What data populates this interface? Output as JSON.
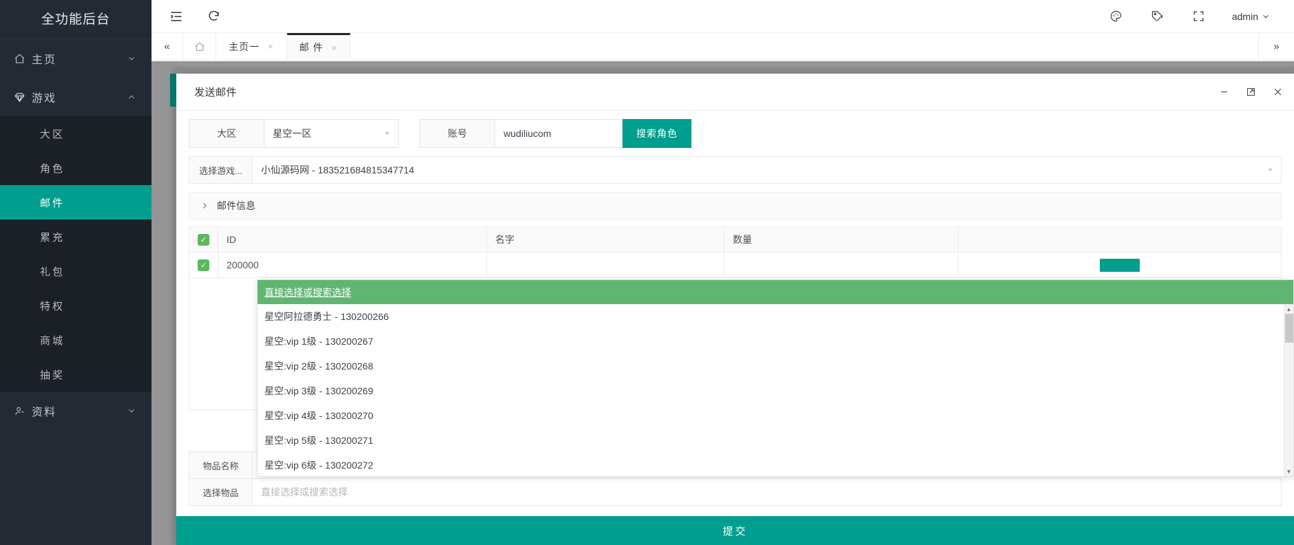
{
  "sidebar": {
    "brand": "全功能后台",
    "groups": [
      {
        "label": "主页",
        "icon": "home-icon",
        "expanded": false,
        "items": []
      },
      {
        "label": "游戏",
        "icon": "diamond-icon",
        "expanded": true,
        "items": [
          {
            "label": "大区",
            "selected": false
          },
          {
            "label": "角色",
            "selected": false
          },
          {
            "label": "邮件",
            "selected": true
          },
          {
            "label": "累充",
            "selected": false
          },
          {
            "label": "礼包",
            "selected": false
          },
          {
            "label": "特权",
            "selected": false
          },
          {
            "label": "商城",
            "selected": false
          },
          {
            "label": "抽奖",
            "selected": false
          }
        ]
      },
      {
        "label": "资料",
        "icon": "user-icon",
        "expanded": false,
        "items": []
      }
    ]
  },
  "header": {
    "collapse_icon": "menu-fold-icon",
    "refresh_icon": "refresh-icon",
    "theme_icon": "palette-icon",
    "tag_icon": "tag-icon",
    "fullscreen_icon": "fullscreen-icon",
    "user": "admin",
    "user_caret": "⌄"
  },
  "tabbar": {
    "prev_icon": "«",
    "home_icon": "home-icon",
    "more_icon": "»",
    "tabs": [
      {
        "label": "主页一",
        "active": false,
        "close": "×"
      },
      {
        "label": "邮 件",
        "active": true,
        "close": "×"
      }
    ]
  },
  "dialog": {
    "title": "发送邮件",
    "controls": {
      "minimize": "minimize-icon",
      "maximize": "maximize-icon",
      "close": "close-icon"
    },
    "form": {
      "region_label": "大区",
      "region_value": "星空一区",
      "account_label": "账号",
      "account_value": "wudiliucom",
      "account_placeholder": "",
      "search_button": "搜索角色",
      "game_label": "选择游戏...",
      "game_value": "小仙源码网 - 183521684815347714",
      "mail_info_label": "邮件信息",
      "item_name_label": "物品名称",
      "item_name_value": "星空:vip 6级 - 130200272",
      "select_item_label": "选择物品",
      "select_item_placeholder": "直接选择或搜索选择"
    },
    "table": {
      "columns": [
        "ID",
        "名字",
        "数量"
      ],
      "rows": [
        {
          "id": "200000",
          "name": "",
          "qty": ""
        }
      ]
    },
    "submit_label": "提交"
  },
  "dropdown": {
    "header": "直接选择或搜索选择",
    "options": [
      "星空阿拉德勇士 - 130200266",
      "星空:vip 1级 - 130200267",
      "星空:vip 2级 - 130200268",
      "星空:vip 3级 - 130200269",
      "星空:vip 4级 - 130200270",
      "星空:vip 5级 - 130200271",
      "星空:vip 6级 - 130200272"
    ],
    "scroll_up": "▲",
    "scroll_down": "▼"
  },
  "colors": {
    "sidebar_bg": "#242a33",
    "submenu_bg": "#1b1f26",
    "accent_teal": "#009e8f",
    "dropdown_green": "#60b571",
    "checkbox_green": "#5cb85c",
    "overlay_gray": "#959595"
  }
}
